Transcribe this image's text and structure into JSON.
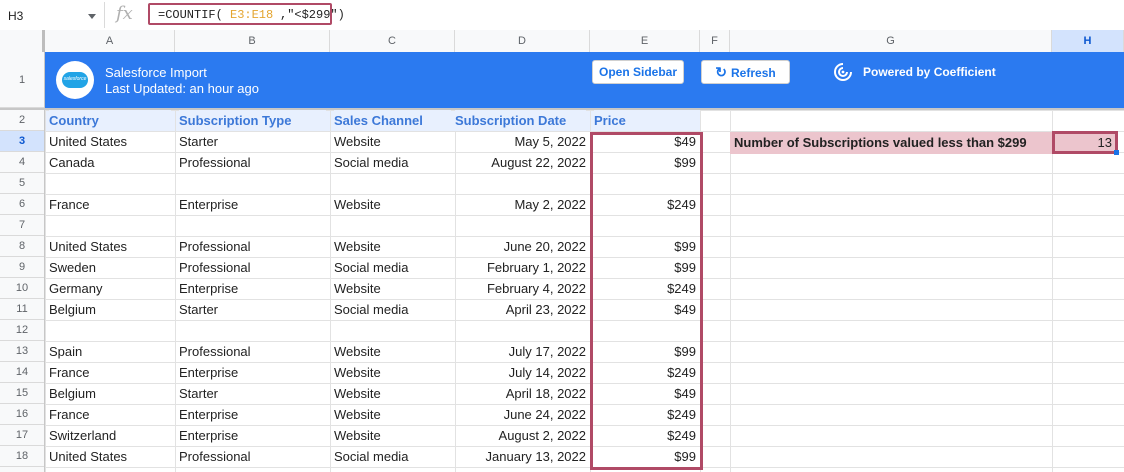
{
  "name_box": "H3",
  "formula": {
    "prefix": "=COUNTIF(",
    "range": "E3:E18",
    "suffix": ",\"<$299\")"
  },
  "fx_icon": "fx-icon",
  "columns": [
    "A",
    "B",
    "C",
    "D",
    "E",
    "F",
    "G",
    "H"
  ],
  "rows": [
    "1",
    "2",
    "3",
    "4",
    "5",
    "6",
    "7",
    "8",
    "9",
    "10",
    "11",
    "12",
    "13",
    "14",
    "15",
    "16",
    "17",
    "18"
  ],
  "banner": {
    "title": "Salesforce Import",
    "subtitle": "Last Updated: an hour ago",
    "logo_text": "salesforce",
    "open_sidebar": "Open Sidebar",
    "refresh": "Refresh",
    "refresh_icon": "↻",
    "powered_by": "Powered by Coefficient",
    "color": "#2b7af0"
  },
  "table": {
    "headers": [
      "Country",
      "Subscription Type",
      "Sales Channel",
      "Subscription Date",
      "Price"
    ],
    "rows": [
      [
        "United States",
        "Starter",
        "Website",
        "May 5, 2022",
        "$49"
      ],
      [
        "Canada",
        "Professional",
        "Social media",
        "August 22, 2022",
        "$99"
      ],
      [
        "",
        "",
        "",
        "",
        ""
      ],
      [
        "France",
        "Enterprise",
        "Website",
        "May 2, 2022",
        "$249"
      ],
      [
        "",
        "",
        "",
        "",
        ""
      ],
      [
        "United States",
        "Professional",
        "Website",
        "June 20, 2022",
        "$99"
      ],
      [
        "Sweden",
        "Professional",
        "Social media",
        "February 1, 2022",
        "$99"
      ],
      [
        "Germany",
        "Enterprise",
        "Website",
        "February 4, 2022",
        "$249"
      ],
      [
        "Belgium",
        "Starter",
        "Social media",
        "April 23, 2022",
        "$49"
      ],
      [
        "",
        "",
        "",
        "",
        ""
      ],
      [
        "Spain",
        "Professional",
        "Website",
        "July 17, 2022",
        "$99"
      ],
      [
        "France",
        "Enterprise",
        "Website",
        "July 14, 2022",
        "$249"
      ],
      [
        "Belgium",
        "Starter",
        "Website",
        "April 18, 2022",
        "$49"
      ],
      [
        "France",
        "Enterprise",
        "Website",
        "June 24, 2022",
        "$249"
      ],
      [
        "Switzerland",
        "Enterprise",
        "Website",
        "August 2, 2022",
        "$249"
      ],
      [
        "United States",
        "Professional",
        "Social media",
        "January 13, 2022",
        "$99"
      ]
    ]
  },
  "summary": {
    "label": "Number of Subscriptions valued less than $299",
    "value": "13",
    "highlight_color": "#ecc5cd",
    "outline_color": "#b04a66"
  }
}
